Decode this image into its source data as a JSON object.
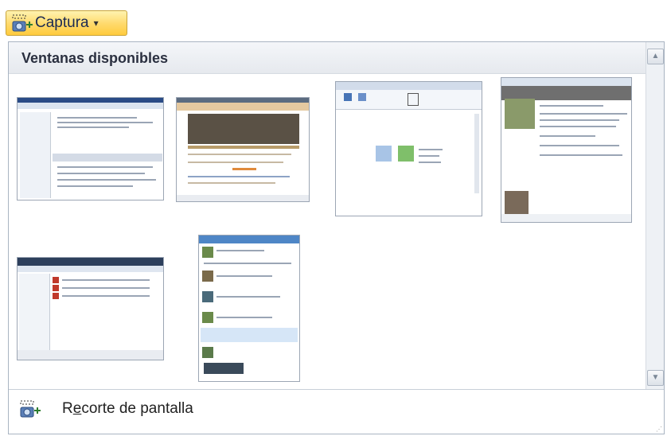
{
  "capture_button": {
    "label": "Captura",
    "icon": "screenshot-icon",
    "arrow": "▾"
  },
  "panel": {
    "title": "Ventanas disponibles",
    "scroll_up": "▲",
    "scroll_down": "▼"
  },
  "windows": [
    {
      "name": "window-thumbnail-word"
    },
    {
      "name": "window-thumbnail-browser"
    },
    {
      "name": "window-thumbnail-paint"
    },
    {
      "name": "window-thumbnail-chat"
    },
    {
      "name": "window-thumbnail-explorer"
    },
    {
      "name": "window-thumbnail-messenger"
    }
  ],
  "footer": {
    "label_prefix": "R",
    "label_underlined": "e",
    "label_rest": "corte de pantalla",
    "icon": "screen-clipping-icon"
  },
  "colors": {
    "button_highlight": "#ffd96a",
    "panel_border": "#a9b4c2"
  }
}
